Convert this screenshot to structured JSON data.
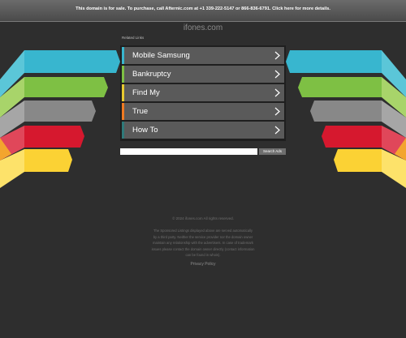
{
  "topbar": {
    "text": "This domain is for sale. To purchase, call Afternic.com at +1 339-222-5147 or 866-836-6791. Click here for more details."
  },
  "site": {
    "title": "ifones.com"
  },
  "related": {
    "label": "Related Links",
    "items": [
      {
        "label": "Mobile Samsung",
        "color": "#38b6cf"
      },
      {
        "label": "Bankruptcy",
        "color": "#7ec044"
      },
      {
        "label": "Find My",
        "color": "#e8ca2f"
      },
      {
        "label": "True",
        "color": "#f07b22"
      },
      {
        "label": "How To",
        "color": "#2f7a7a"
      }
    ]
  },
  "icons": {
    "arrow": "chevron-right-icon"
  },
  "search": {
    "placeholder": "",
    "button_label": "Search Ads"
  },
  "footer": {
    "copyright": "© 2024 ifones.com All rights reserved.",
    "disclaimer": [
      "The Sponsored Listings displayed above are served automatically",
      "by a third party. Neither the service provider nor the domain owner",
      "maintain any relationship with the advertisers. In case of trademark",
      "issues please contact the domain owner directly (contact information",
      "can be found in whois)."
    ],
    "privacy": "Privacy Policy"
  },
  "colors": {
    "background": "#2e2e2e",
    "stripes": [
      "#5bc6d8",
      "#38b6cf",
      "#7ec044",
      "#a8d46a",
      "#a6a6a6",
      "#888888",
      "#e0475a",
      "#d6182e",
      "#f3a52e",
      "#fbd234",
      "#fde26a"
    ]
  }
}
